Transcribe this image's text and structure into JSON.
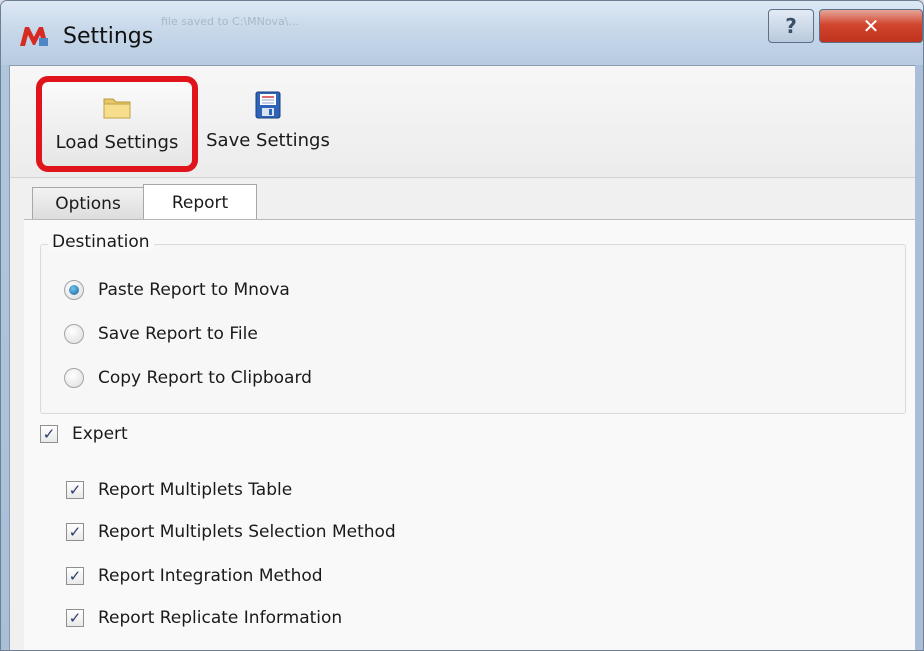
{
  "window": {
    "title": "Settings",
    "blurred_title_fragment": "file saved to C:\\MNova\\..."
  },
  "toolbar": {
    "load_label": "Load Settings",
    "save_label": "Save Settings"
  },
  "tabs": [
    {
      "label": "Options",
      "active": false
    },
    {
      "label": "Report",
      "active": true
    }
  ],
  "destination": {
    "title": "Destination",
    "options": [
      {
        "label": "Paste Report to Mnova",
        "checked": true
      },
      {
        "label": "Save Report to File",
        "checked": false
      },
      {
        "label": "Copy Report to Clipboard",
        "checked": false
      }
    ]
  },
  "expert": {
    "label": "Expert",
    "checked": true
  },
  "report_items": [
    {
      "label": "Report Multiplets Table",
      "checked": true
    },
    {
      "label": "Report Multiplets Selection Method",
      "checked": true
    },
    {
      "label": "Report Integration Method",
      "checked": true
    },
    {
      "label": "Report Replicate Information",
      "checked": true
    }
  ],
  "colors": {
    "highlight": "#e0141b",
    "close_button": "#c0321d",
    "radio_selected": "#1d5c98"
  },
  "icons": {
    "app": "mnova-icon",
    "load": "folder-icon",
    "save": "floppy-disk-icon",
    "help": "help-icon",
    "close": "close-icon"
  }
}
